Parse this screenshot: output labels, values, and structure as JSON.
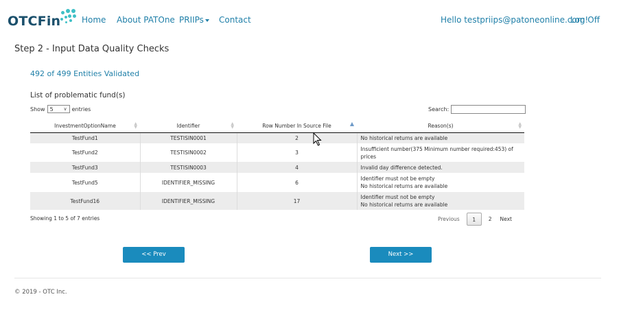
{
  "brand": {
    "name_part1": "OTC",
    "name_part2": "Fin"
  },
  "nav": {
    "home": "Home",
    "about": "About PATOne",
    "priips": "PRIIPs",
    "contact": "Contact",
    "greeting": "Hello testpriips@patoneonline.com!",
    "logoff": "Log Off"
  },
  "page": {
    "title": "Step 2 - Input Data Quality Checks",
    "validated": "492 of 499 Entities Validated",
    "list_title": "List of problematic fund(s)"
  },
  "table_controls": {
    "show_label": "Show",
    "show_value": "5",
    "entries_label": "entries",
    "search_label": "Search:",
    "search_value": ""
  },
  "table": {
    "columns": [
      "InvestmentOptionName",
      "Identifier",
      "Row Number In Source File",
      "Reason(s)"
    ],
    "rows": [
      {
        "name": "TestFund1",
        "identifier": "TESTISIN0001",
        "row": "2",
        "reason1": "No historical returns are available",
        "reason2": ""
      },
      {
        "name": "TestFund2",
        "identifier": "TESTISIN0002",
        "row": "3",
        "reason1": "Insufficient number(375 Minimum number required:453) of",
        "reason2": "prices"
      },
      {
        "name": "TestFund3",
        "identifier": "TESTISIN0003",
        "row": "4",
        "reason1": "Invalid day difference detected.",
        "reason2": ""
      },
      {
        "name": "TestFund5",
        "identifier": "IDENTIFIER_MISSING",
        "row": "6",
        "reason1": "Identifier must not be empty",
        "reason2": "No historical returns are available"
      },
      {
        "name": "TestFund16",
        "identifier": "IDENTIFIER_MISSING",
        "row": "17",
        "reason1": "Identifier must not be empty",
        "reason2": "No historical returns are available"
      }
    ]
  },
  "pagination": {
    "info": "Showing 1 to 5 of 7 entries",
    "previous": "Previous",
    "pages": [
      "1",
      "2"
    ],
    "current_page": "1",
    "next": "Next"
  },
  "buttons": {
    "prev": "<< Prev",
    "next": "Next >>"
  },
  "footer": {
    "copyright": "© 2019 - OTC Inc."
  },
  "colors": {
    "link": "#1f7fa8",
    "brand_dark": "#1a4f6b",
    "brand_teal": "#3fc0c6",
    "button": "#1a8bbd"
  }
}
